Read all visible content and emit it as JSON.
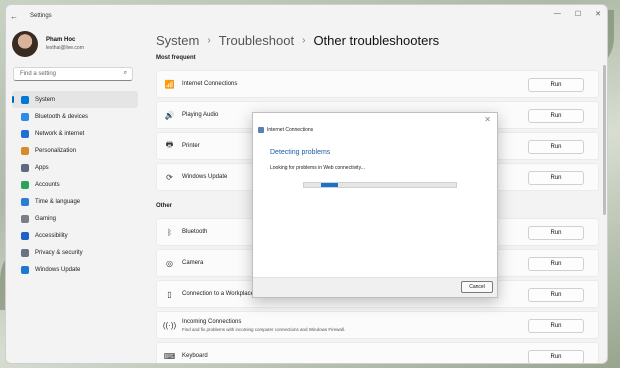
{
  "app": {
    "title": "Settings"
  },
  "window_controls": {
    "minimize": "—",
    "maximize": "☐",
    "close": "✕"
  },
  "profile": {
    "name": "Pham Hoc",
    "email": "lexthai@live.com"
  },
  "search": {
    "placeholder": "Find a setting"
  },
  "sidebar": {
    "items": [
      {
        "label": "System",
        "icon": "system-icon",
        "color": "#0078d4"
      },
      {
        "label": "Bluetooth & devices",
        "icon": "bluetooth-icon",
        "color": "#2f8be6"
      },
      {
        "label": "Network & internet",
        "icon": "network-icon",
        "color": "#1f6fd6"
      },
      {
        "label": "Personalization",
        "icon": "brush-icon",
        "color": "#d98a2b"
      },
      {
        "label": "Apps",
        "icon": "apps-icon",
        "color": "#5c6b7f"
      },
      {
        "label": "Accounts",
        "icon": "accounts-icon",
        "color": "#2da35a"
      },
      {
        "label": "Time & language",
        "icon": "globe-icon",
        "color": "#2a7fd4"
      },
      {
        "label": "Gaming",
        "icon": "gaming-icon",
        "color": "#7a7f86"
      },
      {
        "label": "Accessibility",
        "icon": "accessibility-icon",
        "color": "#1f62c7"
      },
      {
        "label": "Privacy & security",
        "icon": "shield-icon",
        "color": "#6b7380"
      },
      {
        "label": "Windows Update",
        "icon": "update-icon",
        "color": "#1f78d1"
      }
    ]
  },
  "breadcrumb": {
    "root": "System",
    "mid": "Troubleshoot",
    "current": "Other troubleshooters"
  },
  "sections": {
    "most_frequent": "Most frequent",
    "other": "Other"
  },
  "troubleshooters": [
    {
      "label": "Internet Connections",
      "icon": "wifi-icon",
      "button": "Run"
    },
    {
      "label": "Playing Audio",
      "icon": "speaker-icon",
      "button": "Run"
    },
    {
      "label": "Printer",
      "icon": "printer-icon",
      "button": "Run"
    },
    {
      "label": "Windows Update",
      "icon": "refresh-icon",
      "button": "Run"
    },
    {
      "label": "Bluetooth",
      "icon": "bluetooth-icon",
      "button": "Run"
    },
    {
      "label": "Camera",
      "icon": "camera-icon",
      "button": "Run"
    },
    {
      "label": "Connection to a Workplace",
      "icon": "phone-icon",
      "button": "Run"
    },
    {
      "label": "Incoming Connections",
      "sub": "Find and fix problems with incoming computer connections and Windows Firewall.",
      "icon": "antenna-icon",
      "button": "Run"
    },
    {
      "label": "Keyboard",
      "icon": "keyboard-icon",
      "button": "Run"
    }
  ],
  "dialog": {
    "title": "Internet Connections",
    "heading": "Detecting problems",
    "message": "Looking for problems in Web connectivity...",
    "progress": 0.11,
    "cancel": "Cancel"
  }
}
